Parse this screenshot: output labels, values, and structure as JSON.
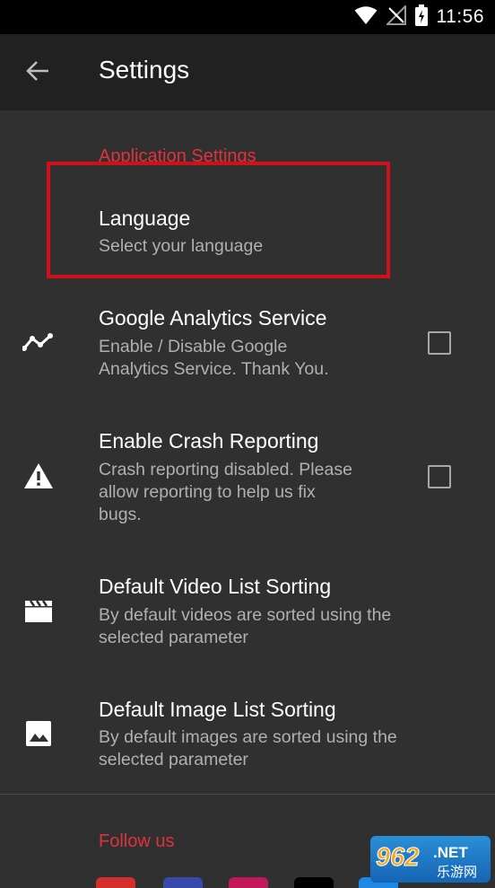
{
  "status_bar": {
    "time": "11:56",
    "icons": [
      "wifi-icon",
      "no-signal-icon",
      "battery-charging-icon"
    ]
  },
  "app_bar": {
    "title": "Settings",
    "back_icon": "arrow-back-icon"
  },
  "application_settings": {
    "header": "Application Settings",
    "items": [
      {
        "title": "Language",
        "summary": "Select your language",
        "icon": ""
      },
      {
        "title": "Google Analytics Service",
        "summary_lines": [
          "Enable / Disable Google",
          "Analytics Service. Thank You."
        ],
        "icon": "analytics-line-icon",
        "checked": false
      },
      {
        "title": "Enable Crash Reporting",
        "summary_lines": [
          "Crash reporting disabled. Please",
          "allow reporting to help us fix",
          "bugs."
        ],
        "icon": "warning-icon",
        "checked": false
      },
      {
        "title": "Default Video List Sorting",
        "summary_lines": [
          "By default videos are sorted using the",
          "selected parameter"
        ],
        "icon": "movie-icon"
      },
      {
        "title": "Default Image List Sorting",
        "summary_lines": [
          "By default images are sorted using the",
          "selected parameter"
        ],
        "icon": "image-icon"
      }
    ]
  },
  "follow_us": {
    "header": "Follow us",
    "social_colors": [
      "#d32f2f",
      "#3949ab",
      "#c2185b",
      "#000000",
      "#1e88e5"
    ]
  },
  "watermark": {
    "text": "962.NET",
    "subtext": "乐游网"
  },
  "colors": {
    "accent": "#e0323c",
    "background": "#303030",
    "appbar": "#212121",
    "highlight_border": "#d0111b"
  }
}
